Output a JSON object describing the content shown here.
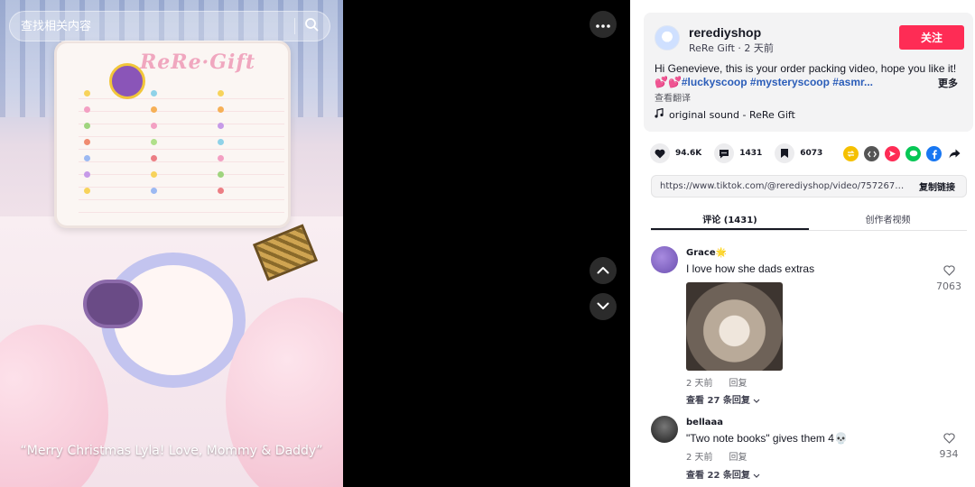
{
  "search": {
    "placeholder": "查找相关内容"
  },
  "video": {
    "board_title": "ReRe·Gift",
    "caption": "“Merry Christmas Lyla! Love, Mommy & Daddy”"
  },
  "author": {
    "username": "rerediyshop",
    "meta": "ReRe Gift · 2 天前",
    "follow_label": "关注"
  },
  "post": {
    "description": "Hi Genevieve, this is your order packing video, hope you like it!",
    "hashtags": "💕💕#luckyscoop #mysteryscoop #asmr...",
    "more_label": "更多",
    "translate_label": "查看翻译",
    "sound": "original sound - ReRe Gift"
  },
  "stats": {
    "likes": "94.6K",
    "comments": "1431",
    "saves": "6073"
  },
  "share_icons": [
    "repost-icon",
    "embed-icon",
    "send-icon",
    "line-icon",
    "facebook-icon",
    "share-arrow-icon"
  ],
  "link": {
    "url": "https://www.tiktok.com/@rerediyshop/video/757267310...",
    "copy_label": "复制链接"
  },
  "tabs": {
    "comments": "评论 (1431)",
    "creator_videos": "创作者视频"
  },
  "comments": [
    {
      "user": "Grace🌟",
      "text": "I love how she dads extras",
      "time": "2 天前",
      "reply": "回复",
      "replies": "查看 27 条回复",
      "likes": "7063"
    },
    {
      "user": "bellaaa",
      "text": "\"Two note books\" gives them 4💀",
      "time": "2 天前",
      "reply": "回复",
      "replies": "查看 22 条回复",
      "likes": "934"
    }
  ],
  "colors": {
    "accent": "#fe2c55",
    "hashtag": "#2b5db9",
    "text": "#161823"
  }
}
